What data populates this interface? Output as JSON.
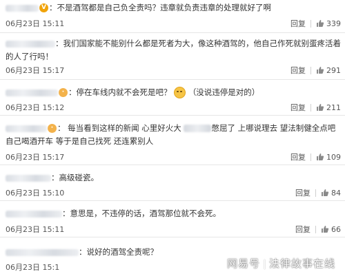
{
  "comments": [
    {
      "text": "不是酒驾都是自己负全责吗？违章就负责违章的处理就好了啊",
      "time": "06月23日 15:11",
      "reply": "回复",
      "likes": "339"
    },
    {
      "text": "我们国家能不能别什么都是死者为大，像这种酒驾的，他自己作死就别蛋疼活着的人了行吗！",
      "time": "06月23日 15:17",
      "reply": "回复",
      "likes": "291"
    },
    {
      "text": "停在车线内就不会死是吧？",
      "text_after": "（没说违停是对的）",
      "time": "06月23日 15:12",
      "reply": "回复",
      "likes": "211"
    },
    {
      "text": "每当看到这样的新闻 心里好火大",
      "text_after": "憋屈了 上哪说理去 望法制健全点吧 自己喝酒开车 等于是自己找死 还连累别人",
      "time": "06月23日 15:17",
      "reply": "回复",
      "likes": "109"
    },
    {
      "text": "高级碰瓷。",
      "time": "06月23日 15:10",
      "reply": "回复",
      "likes": "84"
    },
    {
      "text": "意思是，不违停的话，酒驾那位就不会死。",
      "time": "06月23日 15:11",
      "reply": "回复",
      "likes": "66"
    },
    {
      "text": "说好的酒驾全责呢？",
      "time": "06月23日 15:1",
      "reply": "",
      "likes": ""
    }
  ],
  "icons": {
    "verified": "verified-badge-icon",
    "like": "thumbs-up-icon",
    "emoji": "smirk-emoji-icon"
  },
  "watermark": {
    "brand": "网易号",
    "author": "法律故事在线"
  },
  "colors": {
    "username": "#eb7350",
    "text": "#333333",
    "meta": "#555555",
    "divider": "#e6e6e6"
  }
}
